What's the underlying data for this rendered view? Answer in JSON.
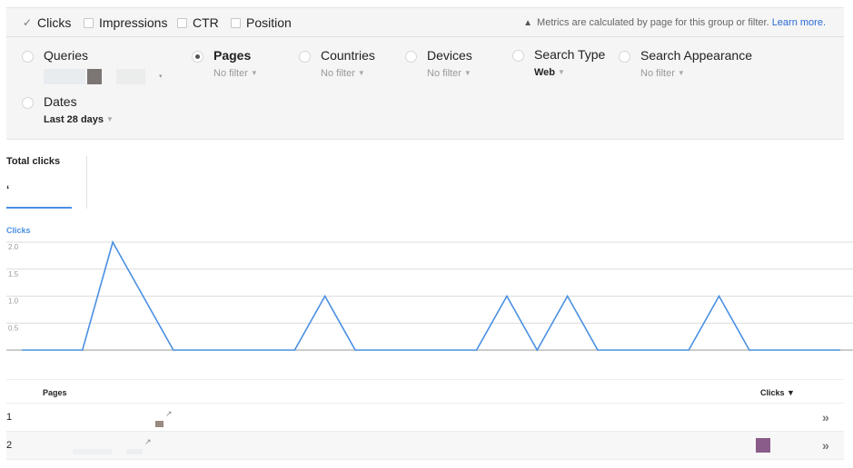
{
  "metrics": {
    "items": [
      {
        "label": "Clicks",
        "checked": true
      },
      {
        "label": "Impressions",
        "checked": false
      },
      {
        "label": "CTR",
        "checked": false
      },
      {
        "label": "Position",
        "checked": false
      }
    ],
    "notice": "Metrics are calculated by page for this group or filter.",
    "learn_more": "Learn more."
  },
  "filters": [
    {
      "name": "Queries",
      "value": "",
      "selected": false,
      "redacted": true
    },
    {
      "name": "Pages",
      "value": "No filter",
      "selected": true
    },
    {
      "name": "Countries",
      "value": "No filter",
      "selected": false
    },
    {
      "name": "Devices",
      "value": "No filter",
      "selected": false
    },
    {
      "name": "Search Type",
      "value": "Web",
      "selected": false
    },
    {
      "name": "Search Appearance",
      "value": "No filter",
      "selected": false
    },
    {
      "name": "Dates",
      "value": "Last 28 days",
      "selected": false
    }
  ],
  "summary": {
    "label": "Total clicks",
    "value": "ʻ"
  },
  "chart_data": {
    "type": "line",
    "title": "Clicks",
    "xlabel": "",
    "ylabel": "Clicks",
    "ylim": [
      0,
      2.0
    ],
    "yticks": [
      "2.0",
      "1.5",
      "1.0",
      "0.5"
    ],
    "grid": true,
    "color": "#4a90e2",
    "series": [
      {
        "name": "Clicks",
        "values": [
          0,
          0,
          0,
          2,
          1,
          0,
          0,
          0,
          0,
          0,
          1,
          0,
          0,
          0,
          0,
          0,
          1,
          0,
          1,
          0,
          0,
          0,
          0,
          1,
          0,
          0,
          0,
          0
        ]
      }
    ]
  },
  "table": {
    "columns": {
      "pages": "Pages",
      "clicks": "Clicks ▼"
    },
    "rows": [
      {
        "index": "1",
        "page": "",
        "clicks": ""
      },
      {
        "index": "2",
        "page": "",
        "clicks": ""
      }
    ],
    "open_icon": "↗",
    "expand_icon": "»"
  }
}
